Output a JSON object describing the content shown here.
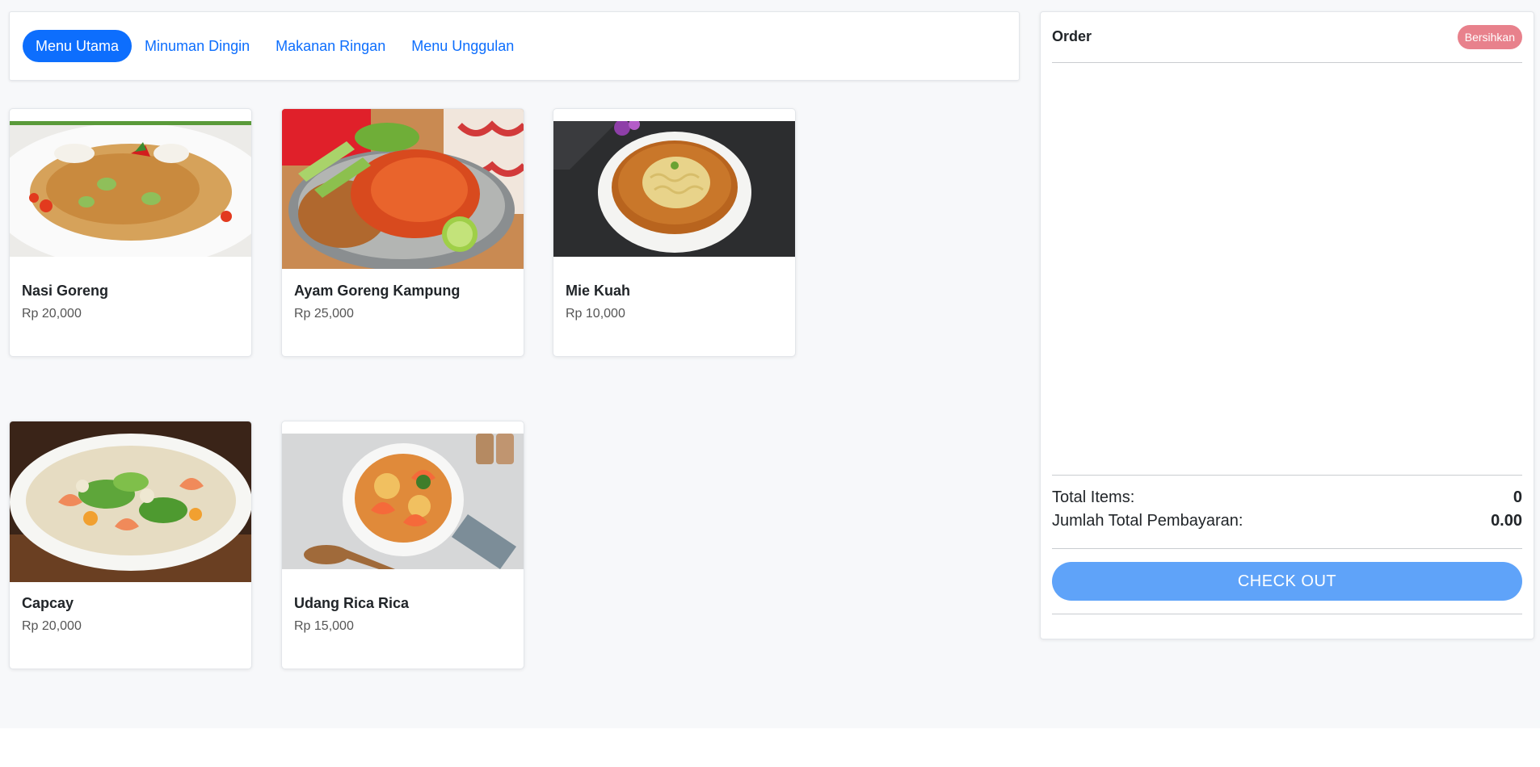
{
  "tabs": [
    {
      "label": "Menu Utama",
      "active": true
    },
    {
      "label": "Minuman Dingin",
      "active": false
    },
    {
      "label": "Makanan Ringan",
      "active": false
    },
    {
      "label": "Menu Unggulan",
      "active": false
    }
  ],
  "products": [
    {
      "name": "Nasi Goreng",
      "price": "Rp 20,000",
      "image": "fried-rice-photo"
    },
    {
      "name": "Ayam Goreng Kampung",
      "price": "Rp 25,000",
      "image": "fried-chicken-photo"
    },
    {
      "name": "Mie Kuah",
      "price": "Rp 10,000",
      "image": "noodle-soup-photo"
    },
    {
      "name": "Capcay",
      "price": "Rp 20,000",
      "image": "stir-fry-vegetables-photo"
    },
    {
      "name": "Udang Rica Rica",
      "price": "Rp 15,000",
      "image": "spicy-shrimp-photo"
    }
  ],
  "order": {
    "title": "Order",
    "clear_label": "Bersihkan",
    "total_items_label": "Total Items:",
    "total_items_value": "0",
    "total_payment_label": "Jumlah Total Pembayaran:",
    "total_payment_value": "0.00",
    "checkout_label": "CHECK OUT"
  },
  "colors": {
    "primary": "#0d6efd",
    "checkout": "#5fa3f9",
    "clear": "#e8818c",
    "background": "#f7f8fa"
  }
}
